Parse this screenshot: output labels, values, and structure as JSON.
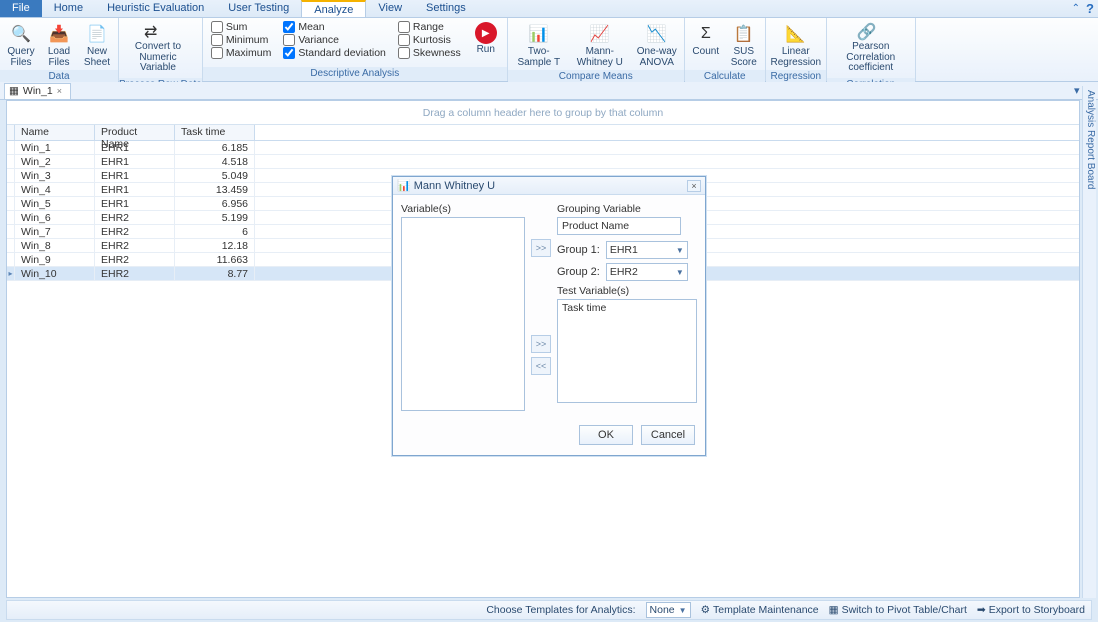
{
  "menu": {
    "items": [
      "File",
      "Home",
      "Heuristic Evaluation",
      "User Testing",
      "Analyze",
      "View",
      "Settings"
    ],
    "active_index": 4
  },
  "ribbon": {
    "groups": [
      {
        "label": "Data",
        "buttons": [
          "Query Files",
          "Load Files",
          "New Sheet"
        ]
      },
      {
        "label": "Process Raw Data",
        "buttons": [
          "Convert to Numeric Variable"
        ]
      },
      {
        "label": "Descriptive Analysis",
        "checks_col1": [
          "Sum",
          "Minimum",
          "Maximum"
        ],
        "checks_col2": [
          "Mean",
          "Variance",
          "Standard deviation"
        ],
        "checks_col3": [
          "Range",
          "Kurtosis",
          "Skewness"
        ],
        "checked": [
          "Mean",
          "Standard deviation"
        ],
        "run": "Run"
      },
      {
        "label": "Compare Means",
        "buttons": [
          "Two-Sample T",
          "Mann-Whitney U",
          "One-way ANOVA"
        ]
      },
      {
        "label": "Calculate",
        "buttons": [
          "Count",
          "SUS Score"
        ]
      },
      {
        "label": "Regression",
        "buttons": [
          "Linear Regression"
        ]
      },
      {
        "label": "Correlation",
        "buttons": [
          "Pearson Correlation coefficient"
        ]
      }
    ]
  },
  "doctab": {
    "title": "Win_1"
  },
  "grid": {
    "group_hint": "Drag a column header here to group by that column",
    "columns": [
      "Name",
      "Product Name",
      "Task time"
    ],
    "rows": [
      {
        "name": "Win_1",
        "product": "EHR1",
        "time": "6.185"
      },
      {
        "name": "Win_2",
        "product": "EHR1",
        "time": "4.518"
      },
      {
        "name": "Win_3",
        "product": "EHR1",
        "time": "5.049"
      },
      {
        "name": "Win_4",
        "product": "EHR1",
        "time": "13.459"
      },
      {
        "name": "Win_5",
        "product": "EHR1",
        "time": "6.956"
      },
      {
        "name": "Win_6",
        "product": "EHR2",
        "time": "5.199"
      },
      {
        "name": "Win_7",
        "product": "EHR2",
        "time": "6"
      },
      {
        "name": "Win_8",
        "product": "EHR2",
        "time": "12.18"
      },
      {
        "name": "Win_9",
        "product": "EHR2",
        "time": "11.663"
      },
      {
        "name": "Win_10",
        "product": "EHR2",
        "time": "8.77"
      }
    ],
    "selected_index": 9
  },
  "right_rail": "Analysis Report Board",
  "dialog": {
    "title": "Mann Whitney U",
    "variables_label": "Variable(s)",
    "grouping_label": "Grouping Variable",
    "grouping_value": "Product Name",
    "group1_label": "Group 1:",
    "group1_value": "EHR1",
    "group2_label": "Group 2:",
    "group2_value": "EHR2",
    "test_label": "Test Variable(s)",
    "test_value": "Task time",
    "move_buttons": [
      ">>",
      ">>",
      "<<"
    ],
    "ok": "OK",
    "cancel": "Cancel"
  },
  "statusbar": {
    "template_label": "Choose Templates for Analytics:",
    "template_value": "None",
    "maintenance": "Template Maintenance",
    "pivot": "Switch to Pivot Table/Chart",
    "storyboard": "Export to Storyboard"
  }
}
